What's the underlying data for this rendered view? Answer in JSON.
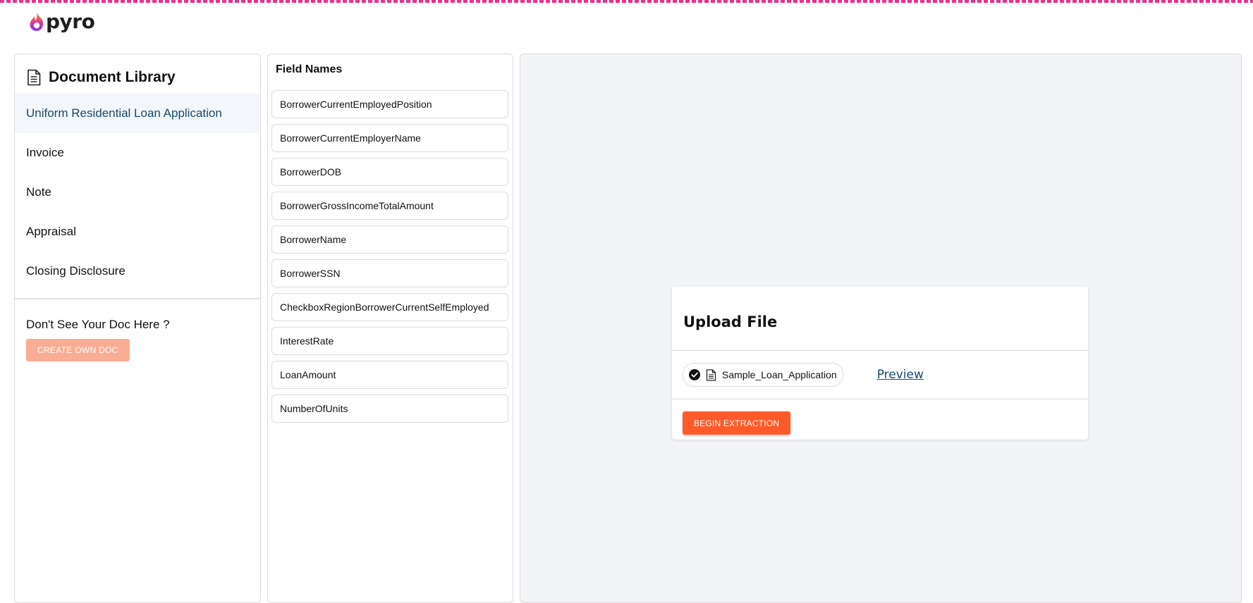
{
  "brand": {
    "name": "pyro",
    "flame_color_top": "#f5a623",
    "flame_color_bottom": "#e8318f",
    "flame_accent": "#7b3fe4"
  },
  "library": {
    "title": "Document Library",
    "items": [
      {
        "label": "Uniform Residential Loan Application",
        "active": true
      },
      {
        "label": "Invoice",
        "active": false
      },
      {
        "label": "Note",
        "active": false
      },
      {
        "label": "Appraisal",
        "active": false
      },
      {
        "label": "Closing Disclosure",
        "active": false
      }
    ],
    "footer_text": "Don't See Your Doc Here ?",
    "create_button": "CREATE OWN DOC"
  },
  "fields": {
    "title": "Field Names",
    "items": [
      "BorrowerCurrentEmployedPosition",
      "BorrowerCurrentEmployerName",
      "BorrowerDOB",
      "BorrowerGrossIncomeTotalAmount",
      "BorrowerName",
      "BorrowerSSN",
      "CheckboxRegionBorrowerCurrentSelfEmployed",
      "InterestRate",
      "LoanAmount",
      "NumberOfUnits"
    ]
  },
  "upload": {
    "title": "Upload File",
    "file_name": "Sample_Loan_Application",
    "file_status_icon": "check-circle-icon",
    "preview_label": "Preview",
    "begin_button": "BEGIN EXTRACTION"
  },
  "colors": {
    "accent": "#ff5a2a",
    "accent_disabled": "#f9ad94",
    "link": "#1a4a6b",
    "active_item_bg": "#f3f6fa",
    "main_bg": "#f3f4f7"
  }
}
